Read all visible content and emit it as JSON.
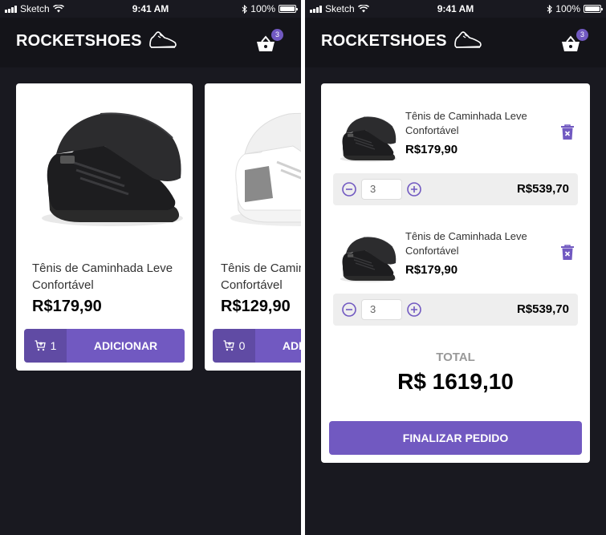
{
  "status_bar": {
    "carrier": "Sketch",
    "time": "9:41 AM",
    "battery": "100%"
  },
  "header": {
    "logo_text": "ROCKETSHOES",
    "cart_count": "3"
  },
  "colors": {
    "background": "#191920",
    "header": "#141419",
    "accent": "#7159c1",
    "card": "#ffffff"
  },
  "products": [
    {
      "title": "Tênis de Caminhada Leve Confortável",
      "price": "R$179,90",
      "amount": "1",
      "button_label": "ADICIONAR",
      "shoe_color": "black"
    },
    {
      "title": "Tênis de Caminhada Leve Confortável",
      "price": "R$129,90",
      "amount": "0",
      "button_label": "ADICIONAR",
      "shoe_color": "white"
    }
  ],
  "cart": {
    "items": [
      {
        "title": "Tênis de Caminhada Leve Confortável",
        "price": "R$179,90",
        "quantity": "3",
        "subtotal": "R$539,70"
      },
      {
        "title": "Tênis de Caminhada Leve Confortável",
        "price": "R$179,90",
        "quantity": "3",
        "subtotal": "R$539,70"
      }
    ],
    "total_label": "TOTAL",
    "total_value": "R$ 1619,10",
    "checkout_label": "FINALIZAR PEDIDO"
  },
  "icons": [
    "sneaker-icon",
    "shopping-basket-icon",
    "add-cart-icon",
    "trash-icon",
    "minus-circle-icon",
    "plus-circle-icon",
    "wifi-icon",
    "bluetooth-icon",
    "battery-icon"
  ]
}
